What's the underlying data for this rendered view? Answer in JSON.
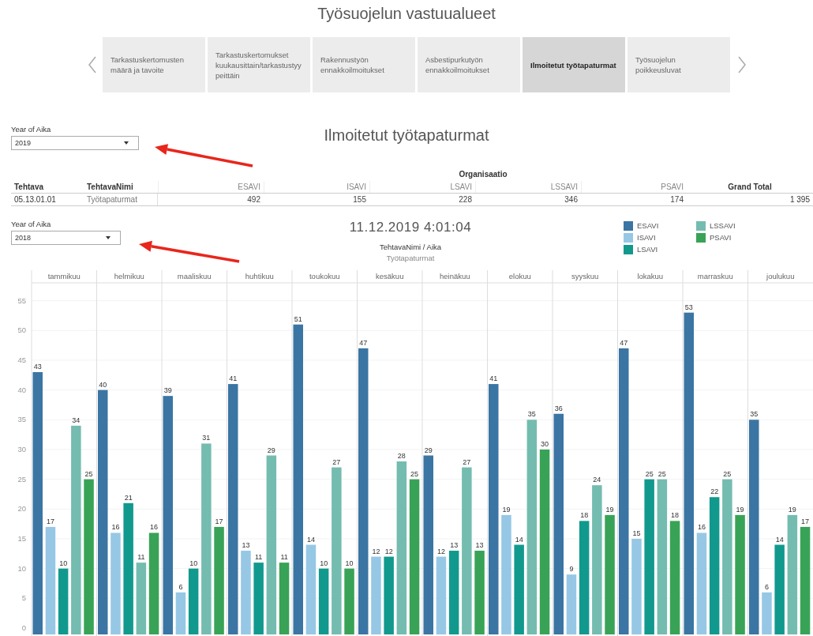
{
  "dashboard_title": "Työsuojelun vastuualueet",
  "tabs": [
    {
      "label": "Tarkastuskertomusten määrä ja tavoite",
      "selected": false
    },
    {
      "label": "Tarkastuskertomukset kuukausittain/tarkastustyypeittäin",
      "selected": false
    },
    {
      "label": "Rakennustyön ennakkoilmoitukset",
      "selected": false
    },
    {
      "label": "Asbestipurkutyön ennakkoilmoitukset",
      "selected": false
    },
    {
      "label": "Ilmoitetut työtapaturmat",
      "selected": true
    },
    {
      "label": "Työsuojelun poikkeusluvat",
      "selected": false
    }
  ],
  "filters": [
    {
      "label": "Year of Aika",
      "value": "2019"
    },
    {
      "label": "Year of Aika",
      "value": "2018"
    }
  ],
  "sheet_title": "Ilmoitetut työtapaturmat",
  "table": {
    "group_header": "Organisaatio",
    "columns": [
      "Tehtava",
      "TehtavaNimi",
      "ESAVI",
      "ISAVI",
      "LSAVI",
      "LSSAVI",
      "PSAVI",
      "Grand Total"
    ],
    "rows": [
      [
        "05.13.01.01",
        "Työtapaturmat",
        "492",
        "155",
        "228",
        "346",
        "174",
        "1 395"
      ]
    ]
  },
  "chart": {
    "timestamp": "11.12.2019 4:01:04",
    "header": "TehtavaNimi / Aika",
    "subheader": "Työtapaturmat",
    "chart_data": {
      "type": "bar",
      "categories": [
        "tammikuu",
        "helmikuu",
        "maaliskuu",
        "huhtikuu",
        "toukokuu",
        "kesäkuu",
        "heinäkuu",
        "elokuu",
        "syyskuu",
        "lokakuu",
        "marraskuu",
        "joulukuu"
      ],
      "series": [
        {
          "name": "ESAVI",
          "color": "#3b75a3",
          "values": [
            43,
            40,
            39,
            41,
            51,
            47,
            29,
            41,
            36,
            47,
            53,
            35
          ]
        },
        {
          "name": "ISAVI",
          "color": "#96c8e5",
          "values": [
            17,
            16,
            6,
            13,
            14,
            12,
            12,
            19,
            9,
            15,
            16,
            6
          ]
        },
        {
          "name": "LSAVI",
          "color": "#12998e",
          "values": [
            10,
            21,
            10,
            11,
            10,
            12,
            13,
            14,
            18,
            25,
            22,
            14
          ]
        },
        {
          "name": "LSSAVI",
          "color": "#74bcb0",
          "values": [
            34,
            11,
            31,
            29,
            27,
            28,
            27,
            35,
            24,
            25,
            25,
            19
          ]
        },
        {
          "name": "PSAVI",
          "color": "#38a356",
          "values": [
            25,
            16,
            17,
            11,
            10,
            25,
            13,
            30,
            19,
            18,
            19,
            17
          ]
        }
      ],
      "ylim": [
        0,
        58
      ],
      "grid": true,
      "yticks": [
        0,
        5,
        10,
        15,
        20,
        25,
        30,
        35,
        40,
        45,
        50,
        55
      ],
      "data_labels": true
    }
  },
  "annotations": [
    {
      "kind": "arrow"
    },
    {
      "kind": "arrow"
    }
  ]
}
